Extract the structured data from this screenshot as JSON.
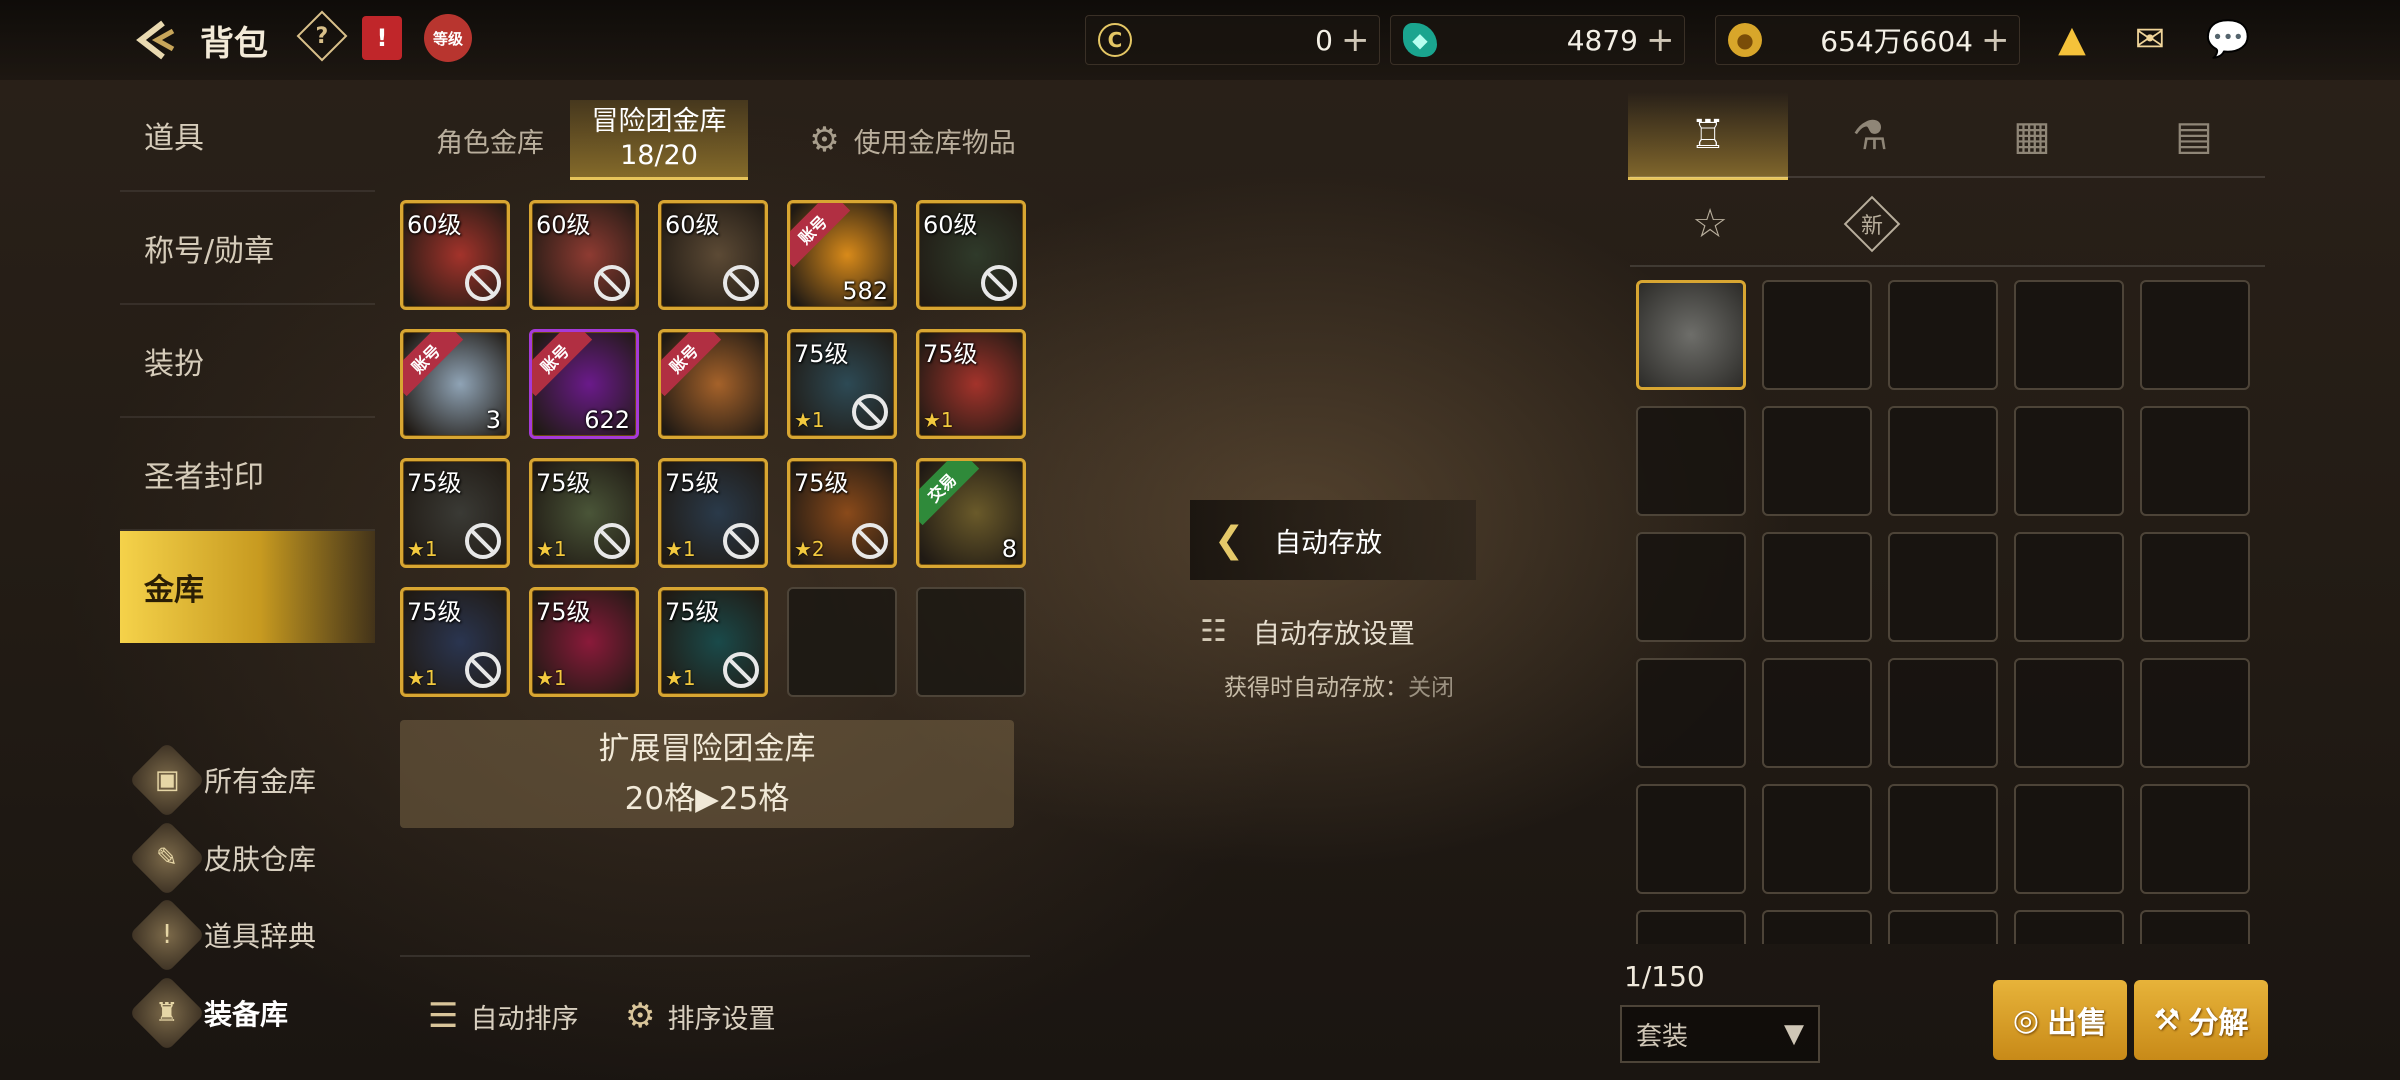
{
  "header": {
    "title": "背包",
    "help_icon": "?",
    "level_badge": "等级",
    "currencies": [
      {
        "icon": "coin-c-icon",
        "value": "0"
      },
      {
        "icon": "green-gem-icon",
        "value": "4879"
      },
      {
        "icon": "gold-coin-icon",
        "value": "654万6604"
      }
    ]
  },
  "nav": {
    "items": [
      "道具",
      "称号/勋章",
      "装扮",
      "圣者封印",
      "金库"
    ],
    "active": "金库",
    "sub_items": [
      "所有金库",
      "皮肤仓库",
      "道具辞典",
      "装备库"
    ]
  },
  "tabs": {
    "character_vault": "角色金库",
    "adventure_vault": "冒险团金库",
    "adventure_vault_count": "18/20",
    "use_vault_items": "使用金库物品"
  },
  "grid": {
    "rows": [
      [
        {
          "level": "60级",
          "banned": true,
          "color": "#a3332b"
        },
        {
          "level": "60级",
          "banned": true,
          "color": "#8e3b32"
        },
        {
          "level": "60级",
          "banned": true,
          "color": "#5c4a35"
        },
        {
          "tag": "账号",
          "count": "582",
          "color": "#d88a1a"
        },
        {
          "level": "60级",
          "banned": true,
          "color": "#2f3a2a"
        }
      ],
      [
        {
          "tag": "账号",
          "count": "3",
          "color": "#8fa3b5"
        },
        {
          "tag": "账号",
          "count": "622",
          "color": "#6a1a8a",
          "purple": true
        },
        {
          "tag": "账号",
          "color": "#a5622a"
        },
        {
          "level": "75级",
          "star": "1",
          "banned": true,
          "color": "#2d4a55"
        },
        {
          "level": "75级",
          "star": "1",
          "color": "#a3332b"
        }
      ],
      [
        {
          "level": "75级",
          "star": "1",
          "banned": true,
          "color": "#3a3a35"
        },
        {
          "level": "75级",
          "star": "1",
          "banned": true,
          "color": "#4a5538"
        },
        {
          "level": "75级",
          "star": "1",
          "banned": true,
          "color": "#2a3a4a"
        },
        {
          "level": "75级",
          "star": "2",
          "banned": true,
          "color": "#8a4a1a"
        },
        {
          "tag": "交易",
          "count": "8",
          "color": "#6a5a2a",
          "tag_green": true
        }
      ],
      [
        {
          "level": "75级",
          "star": "1",
          "banned": true,
          "color": "#2a3550"
        },
        {
          "level": "75级",
          "star": "1",
          "color": "#8a1a3a"
        },
        {
          "level": "75级",
          "star": "1",
          "banned": true,
          "color": "#1a4a4a"
        },
        {
          "empty": true
        },
        {
          "empty": true
        }
      ]
    ]
  },
  "expand": {
    "line1": "扩展冒险团金库",
    "line2": "20格▶25格"
  },
  "bottom": {
    "auto_sort": "自动排序",
    "sort_settings": "排序设置"
  },
  "auto_store": {
    "button": "自动存放",
    "settings": "自动存放设置",
    "note_label": "获得时自动存放：",
    "note_value": "关闭"
  },
  "right": {
    "tabs": [
      "armor-icon",
      "potion-icon",
      "cubes-icon",
      "cards-icon"
    ],
    "sub_tabs": [
      "pentagram-icon",
      "新"
    ],
    "count": "1/150",
    "filter": "套装",
    "sell": "出售",
    "disassemble": "分解"
  },
  "colors": {
    "accent": "#e7c45a",
    "active_nav": "#f5d24a",
    "item_border": "#d8a632"
  }
}
